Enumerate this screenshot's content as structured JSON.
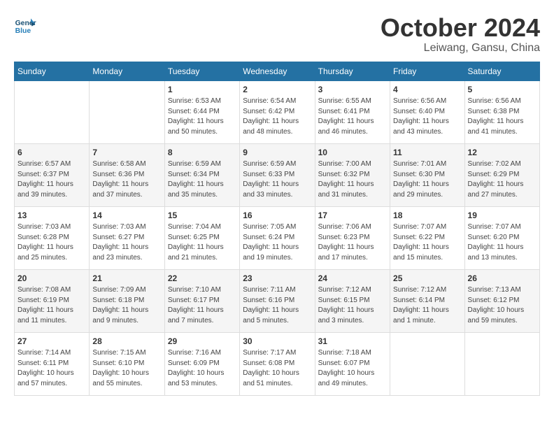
{
  "header": {
    "logo_line1": "General",
    "logo_line2": "Blue",
    "month": "October 2024",
    "location": "Leiwang, Gansu, China"
  },
  "weekdays": [
    "Sunday",
    "Monday",
    "Tuesday",
    "Wednesday",
    "Thursday",
    "Friday",
    "Saturday"
  ],
  "weeks": [
    [
      {
        "day": "",
        "info": ""
      },
      {
        "day": "",
        "info": ""
      },
      {
        "day": "1",
        "info": "Sunrise: 6:53 AM\nSunset: 6:44 PM\nDaylight: 11 hours\nand 50 minutes."
      },
      {
        "day": "2",
        "info": "Sunrise: 6:54 AM\nSunset: 6:42 PM\nDaylight: 11 hours\nand 48 minutes."
      },
      {
        "day": "3",
        "info": "Sunrise: 6:55 AM\nSunset: 6:41 PM\nDaylight: 11 hours\nand 46 minutes."
      },
      {
        "day": "4",
        "info": "Sunrise: 6:56 AM\nSunset: 6:40 PM\nDaylight: 11 hours\nand 43 minutes."
      },
      {
        "day": "5",
        "info": "Sunrise: 6:56 AM\nSunset: 6:38 PM\nDaylight: 11 hours\nand 41 minutes."
      }
    ],
    [
      {
        "day": "6",
        "info": "Sunrise: 6:57 AM\nSunset: 6:37 PM\nDaylight: 11 hours\nand 39 minutes."
      },
      {
        "day": "7",
        "info": "Sunrise: 6:58 AM\nSunset: 6:36 PM\nDaylight: 11 hours\nand 37 minutes."
      },
      {
        "day": "8",
        "info": "Sunrise: 6:59 AM\nSunset: 6:34 PM\nDaylight: 11 hours\nand 35 minutes."
      },
      {
        "day": "9",
        "info": "Sunrise: 6:59 AM\nSunset: 6:33 PM\nDaylight: 11 hours\nand 33 minutes."
      },
      {
        "day": "10",
        "info": "Sunrise: 7:00 AM\nSunset: 6:32 PM\nDaylight: 11 hours\nand 31 minutes."
      },
      {
        "day": "11",
        "info": "Sunrise: 7:01 AM\nSunset: 6:30 PM\nDaylight: 11 hours\nand 29 minutes."
      },
      {
        "day": "12",
        "info": "Sunrise: 7:02 AM\nSunset: 6:29 PM\nDaylight: 11 hours\nand 27 minutes."
      }
    ],
    [
      {
        "day": "13",
        "info": "Sunrise: 7:03 AM\nSunset: 6:28 PM\nDaylight: 11 hours\nand 25 minutes."
      },
      {
        "day": "14",
        "info": "Sunrise: 7:03 AM\nSunset: 6:27 PM\nDaylight: 11 hours\nand 23 minutes."
      },
      {
        "day": "15",
        "info": "Sunrise: 7:04 AM\nSunset: 6:25 PM\nDaylight: 11 hours\nand 21 minutes."
      },
      {
        "day": "16",
        "info": "Sunrise: 7:05 AM\nSunset: 6:24 PM\nDaylight: 11 hours\nand 19 minutes."
      },
      {
        "day": "17",
        "info": "Sunrise: 7:06 AM\nSunset: 6:23 PM\nDaylight: 11 hours\nand 17 minutes."
      },
      {
        "day": "18",
        "info": "Sunrise: 7:07 AM\nSunset: 6:22 PM\nDaylight: 11 hours\nand 15 minutes."
      },
      {
        "day": "19",
        "info": "Sunrise: 7:07 AM\nSunset: 6:20 PM\nDaylight: 11 hours\nand 13 minutes."
      }
    ],
    [
      {
        "day": "20",
        "info": "Sunrise: 7:08 AM\nSunset: 6:19 PM\nDaylight: 11 hours\nand 11 minutes."
      },
      {
        "day": "21",
        "info": "Sunrise: 7:09 AM\nSunset: 6:18 PM\nDaylight: 11 hours\nand 9 minutes."
      },
      {
        "day": "22",
        "info": "Sunrise: 7:10 AM\nSunset: 6:17 PM\nDaylight: 11 hours\nand 7 minutes."
      },
      {
        "day": "23",
        "info": "Sunrise: 7:11 AM\nSunset: 6:16 PM\nDaylight: 11 hours\nand 5 minutes."
      },
      {
        "day": "24",
        "info": "Sunrise: 7:12 AM\nSunset: 6:15 PM\nDaylight: 11 hours\nand 3 minutes."
      },
      {
        "day": "25",
        "info": "Sunrise: 7:12 AM\nSunset: 6:14 PM\nDaylight: 11 hours\nand 1 minute."
      },
      {
        "day": "26",
        "info": "Sunrise: 7:13 AM\nSunset: 6:12 PM\nDaylight: 10 hours\nand 59 minutes."
      }
    ],
    [
      {
        "day": "27",
        "info": "Sunrise: 7:14 AM\nSunset: 6:11 PM\nDaylight: 10 hours\nand 57 minutes."
      },
      {
        "day": "28",
        "info": "Sunrise: 7:15 AM\nSunset: 6:10 PM\nDaylight: 10 hours\nand 55 minutes."
      },
      {
        "day": "29",
        "info": "Sunrise: 7:16 AM\nSunset: 6:09 PM\nDaylight: 10 hours\nand 53 minutes."
      },
      {
        "day": "30",
        "info": "Sunrise: 7:17 AM\nSunset: 6:08 PM\nDaylight: 10 hours\nand 51 minutes."
      },
      {
        "day": "31",
        "info": "Sunrise: 7:18 AM\nSunset: 6:07 PM\nDaylight: 10 hours\nand 49 minutes."
      },
      {
        "day": "",
        "info": ""
      },
      {
        "day": "",
        "info": ""
      }
    ]
  ]
}
